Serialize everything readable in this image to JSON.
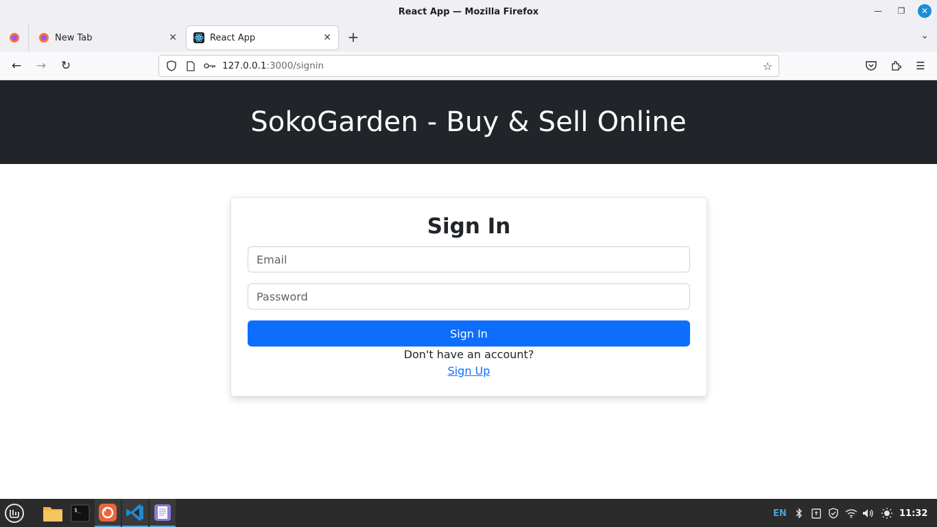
{
  "window": {
    "title": "React App — Mozilla Firefox"
  },
  "tabs": [
    {
      "label": "New Tab",
      "icon": "firefox-icon"
    },
    {
      "label": "React App",
      "icon": "react-icon",
      "active": true
    }
  ],
  "urlbar": {
    "host": "127.0.0.1",
    "path": ":3000/signin"
  },
  "page": {
    "hero_title": "SokoGarden - Buy & Sell Online",
    "form": {
      "heading": "Sign In",
      "email_placeholder": "Email",
      "password_placeholder": "Password",
      "submit_label": "Sign In",
      "account_prompt": "Don't have an account?",
      "signup_link": "Sign Up"
    }
  },
  "taskbar": {
    "language": "EN",
    "clock": "11:32"
  },
  "colors": {
    "hero_bg": "#212529",
    "primary": "#0d6efd"
  }
}
